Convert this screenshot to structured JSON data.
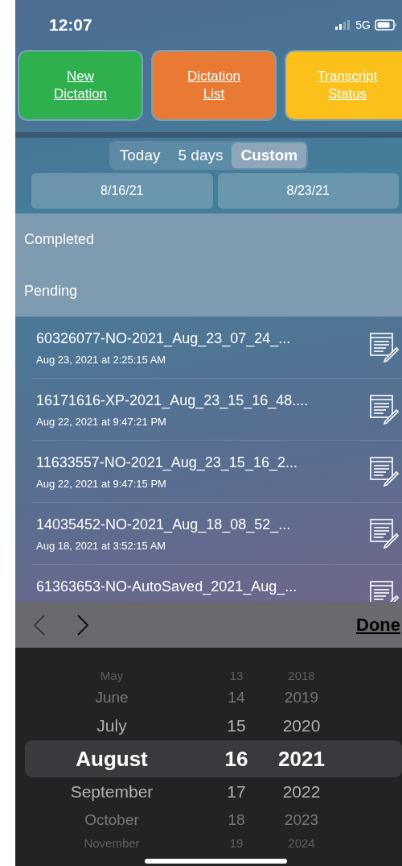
{
  "status_bar": {
    "time": "12:07",
    "network": "5G"
  },
  "actions": [
    {
      "label": "New Dictation",
      "color": "#2eb04f"
    },
    {
      "label": "Dictation List",
      "color": "#e87a33"
    },
    {
      "label": "Transcript Status",
      "color": "#fcc01a"
    }
  ],
  "range_tabs": [
    {
      "label": "Today",
      "selected": false
    },
    {
      "label": "5 days",
      "selected": false
    },
    {
      "label": "Custom",
      "selected": true
    }
  ],
  "date_fields": [
    {
      "value": "8/16/21"
    },
    {
      "value": "8/23/21"
    }
  ],
  "summary": [
    {
      "label": "Completed"
    },
    {
      "label": "Pending"
    }
  ],
  "dictations": [
    {
      "name": "60326077-NO-2021_Aug_23_07_24_...",
      "date": "Aug 23, 2021 at 2:25:15 AM"
    },
    {
      "name": "16171616-XP-2021_Aug_23_15_16_48....",
      "date": "Aug 22, 2021 at 9:47:21 PM"
    },
    {
      "name": "11633557-NO-2021_Aug_23_15_16_2...",
      "date": "Aug 22, 2021 at 9:47:15 PM"
    },
    {
      "name": "14035452-NO-2021_Aug_18_08_52_...",
      "date": "Aug 18, 2021 at 3:52:15 AM"
    },
    {
      "name": "61363653-NO-AutoSaved_2021_Aug_..."
    }
  ],
  "picker_toolbar": {
    "done": "Done"
  },
  "picker": {
    "columns": [
      {
        "items": [
          {
            "text": "May",
            "selected": false
          },
          {
            "text": "June",
            "selected": false
          },
          {
            "text": "July",
            "selected": false
          },
          {
            "text": "August",
            "selected": true
          },
          {
            "text": "September",
            "selected": false
          },
          {
            "text": "October",
            "selected": false
          },
          {
            "text": "November",
            "selected": false
          }
        ]
      },
      {
        "items": [
          {
            "text": "13",
            "selected": false
          },
          {
            "text": "14",
            "selected": false
          },
          {
            "text": "15",
            "selected": false
          },
          {
            "text": "16",
            "selected": true
          },
          {
            "text": "17",
            "selected": false
          },
          {
            "text": "18",
            "selected": false
          },
          {
            "text": "19",
            "selected": false
          }
        ]
      },
      {
        "items": [
          {
            "text": "2018",
            "selected": false
          },
          {
            "text": "2019",
            "selected": false
          },
          {
            "text": "2020",
            "selected": false
          },
          {
            "text": "2021",
            "selected": true
          },
          {
            "text": "2022",
            "selected": false
          },
          {
            "text": "2023",
            "selected": false
          },
          {
            "text": "2024",
            "selected": false
          }
        ]
      }
    ]
  }
}
